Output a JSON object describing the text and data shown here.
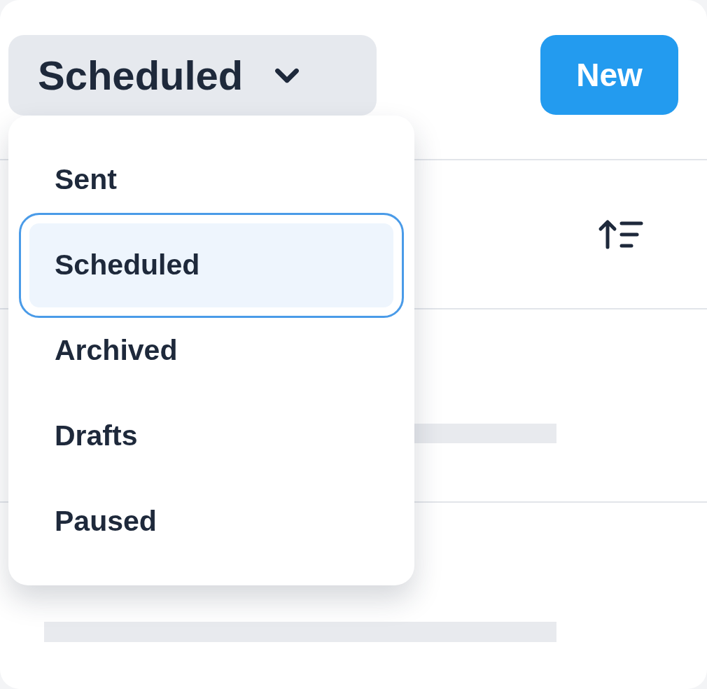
{
  "filter_dropdown": {
    "label": "Scheduled",
    "expanded": true
  },
  "new_button": {
    "label": "New"
  },
  "menu": {
    "items": [
      {
        "label": "Sent",
        "selected": false
      },
      {
        "label": "Scheduled",
        "selected": true
      },
      {
        "label": "Archived",
        "selected": false
      },
      {
        "label": "Drafts",
        "selected": false
      },
      {
        "label": "Paused",
        "selected": false
      }
    ]
  }
}
